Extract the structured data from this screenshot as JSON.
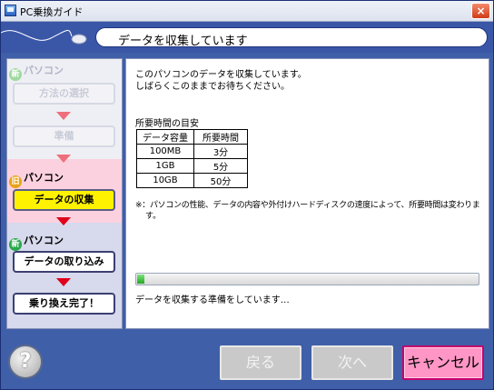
{
  "window": {
    "title": "PC乗換ガイド",
    "close_glyph": "×"
  },
  "header": {
    "title": "データを収集しています"
  },
  "sidebar": {
    "new_pc_badge": "新",
    "old_pc_badge": "旧",
    "section_new_top": "パソコン",
    "steps": [
      {
        "label": "方法の選択"
      },
      {
        "label": "準備"
      },
      {
        "label": "データの収集"
      },
      {
        "label": "データの取り込み"
      },
      {
        "label": "乗り換え完了！"
      }
    ],
    "section_old": "パソコン",
    "section_new_bottom": "パソコン"
  },
  "content": {
    "intro_line1": "このパソコンのデータを収集しています。",
    "intro_line2": "しばらくこのままでお待ちください。",
    "table_caption": "所要時間の目安",
    "table": {
      "headers": [
        "データ容量",
        "所要時間"
      ],
      "rows": [
        [
          "100MB",
          "3分"
        ],
        [
          "1GB",
          "5分"
        ],
        [
          "10GB",
          "50分"
        ]
      ]
    },
    "note_line1": "※：パソコンの性能、データの内容や外付けハードディスクの速度によって、所要時間は変わりま",
    "note_line2": "す。",
    "progress_percent": 2,
    "status": "データを収集する準備をしています…"
  },
  "footer": {
    "help_glyph": "?",
    "back": "戻る",
    "next": "次へ",
    "cancel": "キャンセル"
  },
  "colors": {
    "accent": "#3f5fa8",
    "current_step": "#fff200",
    "cancel": "#ff96c5",
    "arrow": "#e0001a"
  }
}
